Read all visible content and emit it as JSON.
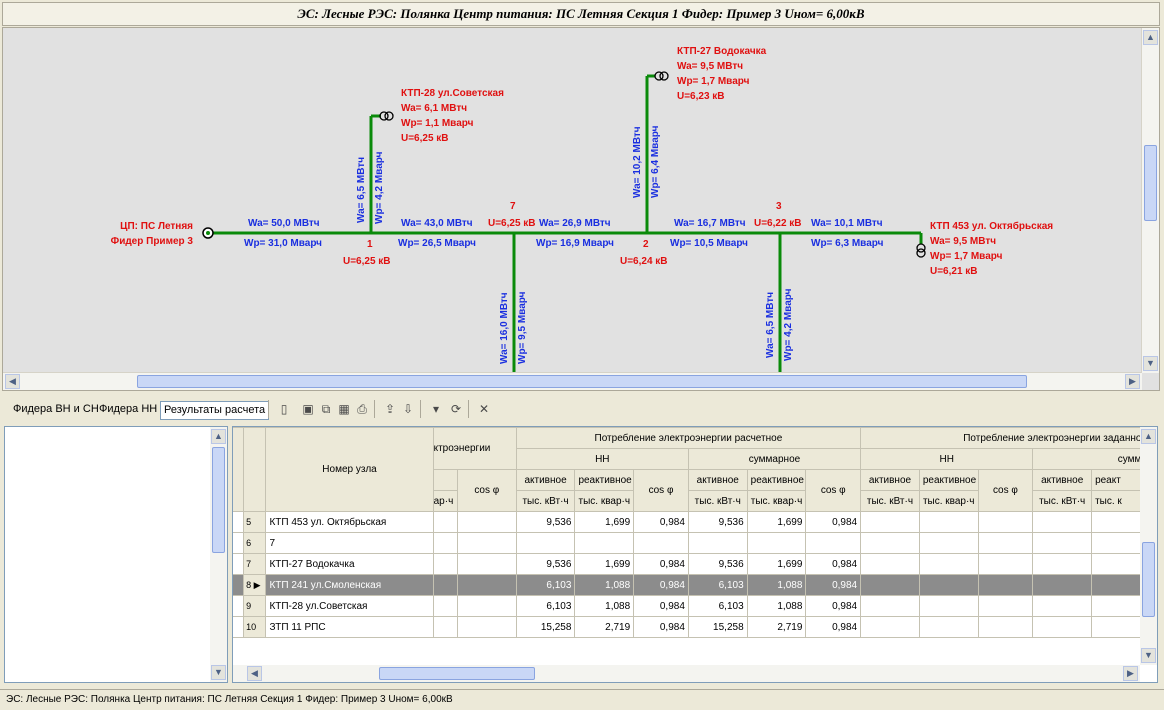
{
  "title": "ЭС: Лесные   РЭС: Полянка   Центр питания: ПС Летняя Секция 1   Фидер: Пример 3   Uном= 6,00кВ",
  "diagram": {
    "source": {
      "line1": "ЦП: ПС Летняя",
      "line2": "Фидер Пример 3"
    },
    "segments": [
      {
        "wa": "Wa= 50,0 МВтч",
        "wp": "Wp= 31,0 Мварч"
      },
      {
        "wa": "Wa= 43,0 МВтч",
        "wp": "Wp= 26,5 Мварч"
      },
      {
        "wa": "Wa= 26,9 МВтч",
        "wp": "Wp= 16,9 Мварч"
      },
      {
        "wa": "Wa= 16,7 МВтч",
        "wp": "Wp= 10,5 Мварч"
      },
      {
        "wa": "Wa= 10,1 МВтч",
        "wp": "Wp= 6,3 Мварч"
      }
    ],
    "nodes": [
      {
        "num": "1",
        "u": "U=6,25 кВ"
      },
      {
        "num": "7",
        "u": "U=6,25 кВ"
      },
      {
        "num": "2",
        "u": "U=6,24 кВ"
      },
      {
        "num": "3",
        "u": "U=6,22 кВ"
      }
    ],
    "branches": [
      {
        "wa": "Wa= 6,5 МВтч",
        "wp": "Wp= 4,2 Мварч"
      },
      {
        "wa": "Wa= 16,0 МВтч",
        "wp": "Wp= 9,5 Мварч"
      },
      {
        "wa": "Wa= 10,2 МВтч",
        "wp": "Wp= 6,4 Мварч"
      },
      {
        "wa": "Wa= 6,5 МВтч",
        "wp": "Wp= 4,2 Мварч"
      }
    ],
    "ktp": [
      {
        "name": "КТП-28 ул.Советская",
        "wa": "Wa= 6,1 МВтч",
        "wp": "Wp= 1,1 Мварч",
        "u": "U=6,25 кВ"
      },
      {
        "name": "КТП-27 Водокачка",
        "wa": "Wa= 9,5 МВтч",
        "wp": "Wp= 1,7 Мварч",
        "u": "U=6,23 кВ"
      },
      {
        "name": "КТП 453 ул. Октябрьская",
        "wa": "Wa= 9,5 МВтч",
        "wp": "Wp= 1,7 Мварч",
        "u": "U=6,21 кВ"
      }
    ],
    "colors": {
      "line": "#0a8a0a",
      "red": "#e01010",
      "blue": "#1a2fe0",
      "canvas": "#e1e1e1"
    }
  },
  "toolbar": {
    "tabs": [
      "Фидера ВН и СН",
      "Фидера НН",
      "Результаты расчета"
    ],
    "active_tab": "Результаты расчета",
    "icons": [
      "clipboard-icon",
      "save-icon",
      "copy-icon",
      "excel-icon",
      "print-icon",
      "export-icon",
      "import-icon",
      "filter-icon",
      "refresh-icon",
      "clear-icon"
    ]
  },
  "grid": {
    "headers": {
      "node": "Номер узла",
      "energy_partial": "ктроэнергии",
      "calc": "Потребление электроэнергии расчетное",
      "given": "Потребление электроэнергии заданное",
      "nn": "НН",
      "total": "суммарное",
      "total_cut": "сумма",
      "active": "активное",
      "reactive": "реактивное",
      "reactive_cut": "реакт",
      "cos": "cos φ",
      "var_cut": "ар·ч",
      "kwh": "тыс. кВт·ч",
      "kvarh": "тыс. квар·ч",
      "kvarh_cut": "тыс. к"
    },
    "rows": [
      {
        "rn": "5",
        "name": "КТП 453 ул. Октябрьская",
        "a": "9,536",
        "r": "1,699",
        "c": "0,984",
        "sa": "9,536",
        "sr": "1,699",
        "sc": "0,984"
      },
      {
        "rn": "6",
        "name": "7",
        "a": "",
        "r": "",
        "c": "",
        "sa": "",
        "sr": "",
        "sc": ""
      },
      {
        "rn": "7",
        "name": "КТП-27 Водокачка",
        "a": "9,536",
        "r": "1,699",
        "c": "0,984",
        "sa": "9,536",
        "sr": "1,699",
        "sc": "0,984"
      },
      {
        "rn": "8 ▶",
        "name": "КТП 241  ул.Смоленская",
        "a": "6,103",
        "r": "1,088",
        "c": "0,984",
        "sa": "6,103",
        "sr": "1,088",
        "sc": "0,984"
      },
      {
        "rn": "9",
        "name": "КТП-28 ул.Советская",
        "a": "6,103",
        "r": "1,088",
        "c": "0,984",
        "sa": "6,103",
        "sr": "1,088",
        "sc": "0,984"
      },
      {
        "rn": "10",
        "name": "ЗТП 11 РПС",
        "a": "15,258",
        "r": "2,719",
        "c": "0,984",
        "sa": "15,258",
        "sr": "2,719",
        "sc": "0,984"
      }
    ]
  },
  "status": "ЭС: Лесные   РЭС: Полянка   Центр питания: ПС Летняя Секция 1   Фидер: Пример 3   Uном= 6,00кВ"
}
